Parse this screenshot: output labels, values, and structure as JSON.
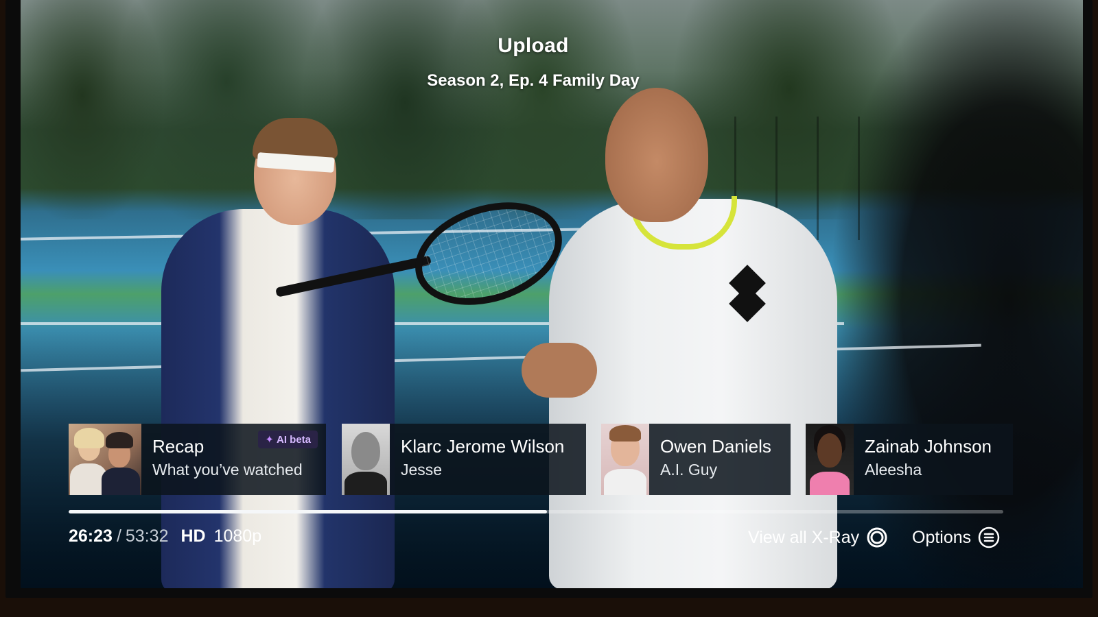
{
  "player": {
    "show_title": "Upload",
    "episode_title": "Season 2, Ep. 4 Family Day"
  },
  "xray": {
    "cards": [
      {
        "type": "recap",
        "primary": "Recap",
        "secondary": "What you’ve watched",
        "badge": "AI beta"
      },
      {
        "type": "cast",
        "primary": "Klarc Jerome Wilson",
        "secondary": "Jesse"
      },
      {
        "type": "cast",
        "primary": "Owen Daniels",
        "secondary": "A.I. Guy"
      },
      {
        "type": "cast",
        "primary": "Zainab Johnson",
        "secondary": "Aleesha"
      }
    ]
  },
  "playback": {
    "current_time": "26:23",
    "separator": "/",
    "total_time": "53:32",
    "quality_badge": "HD",
    "resolution": "1080p",
    "progress_fraction": 0.512
  },
  "actions": {
    "xray_label": "View all X-Ray",
    "options_label": "Options"
  },
  "colors": {
    "ai_badge_text": "#d6b9ff",
    "progress_fill": "#f5f7f9",
    "collar_accent": "#d6e43a"
  },
  "icons": [
    "sparkle-icon",
    "xray-ring-icon",
    "options-menu-icon"
  ]
}
